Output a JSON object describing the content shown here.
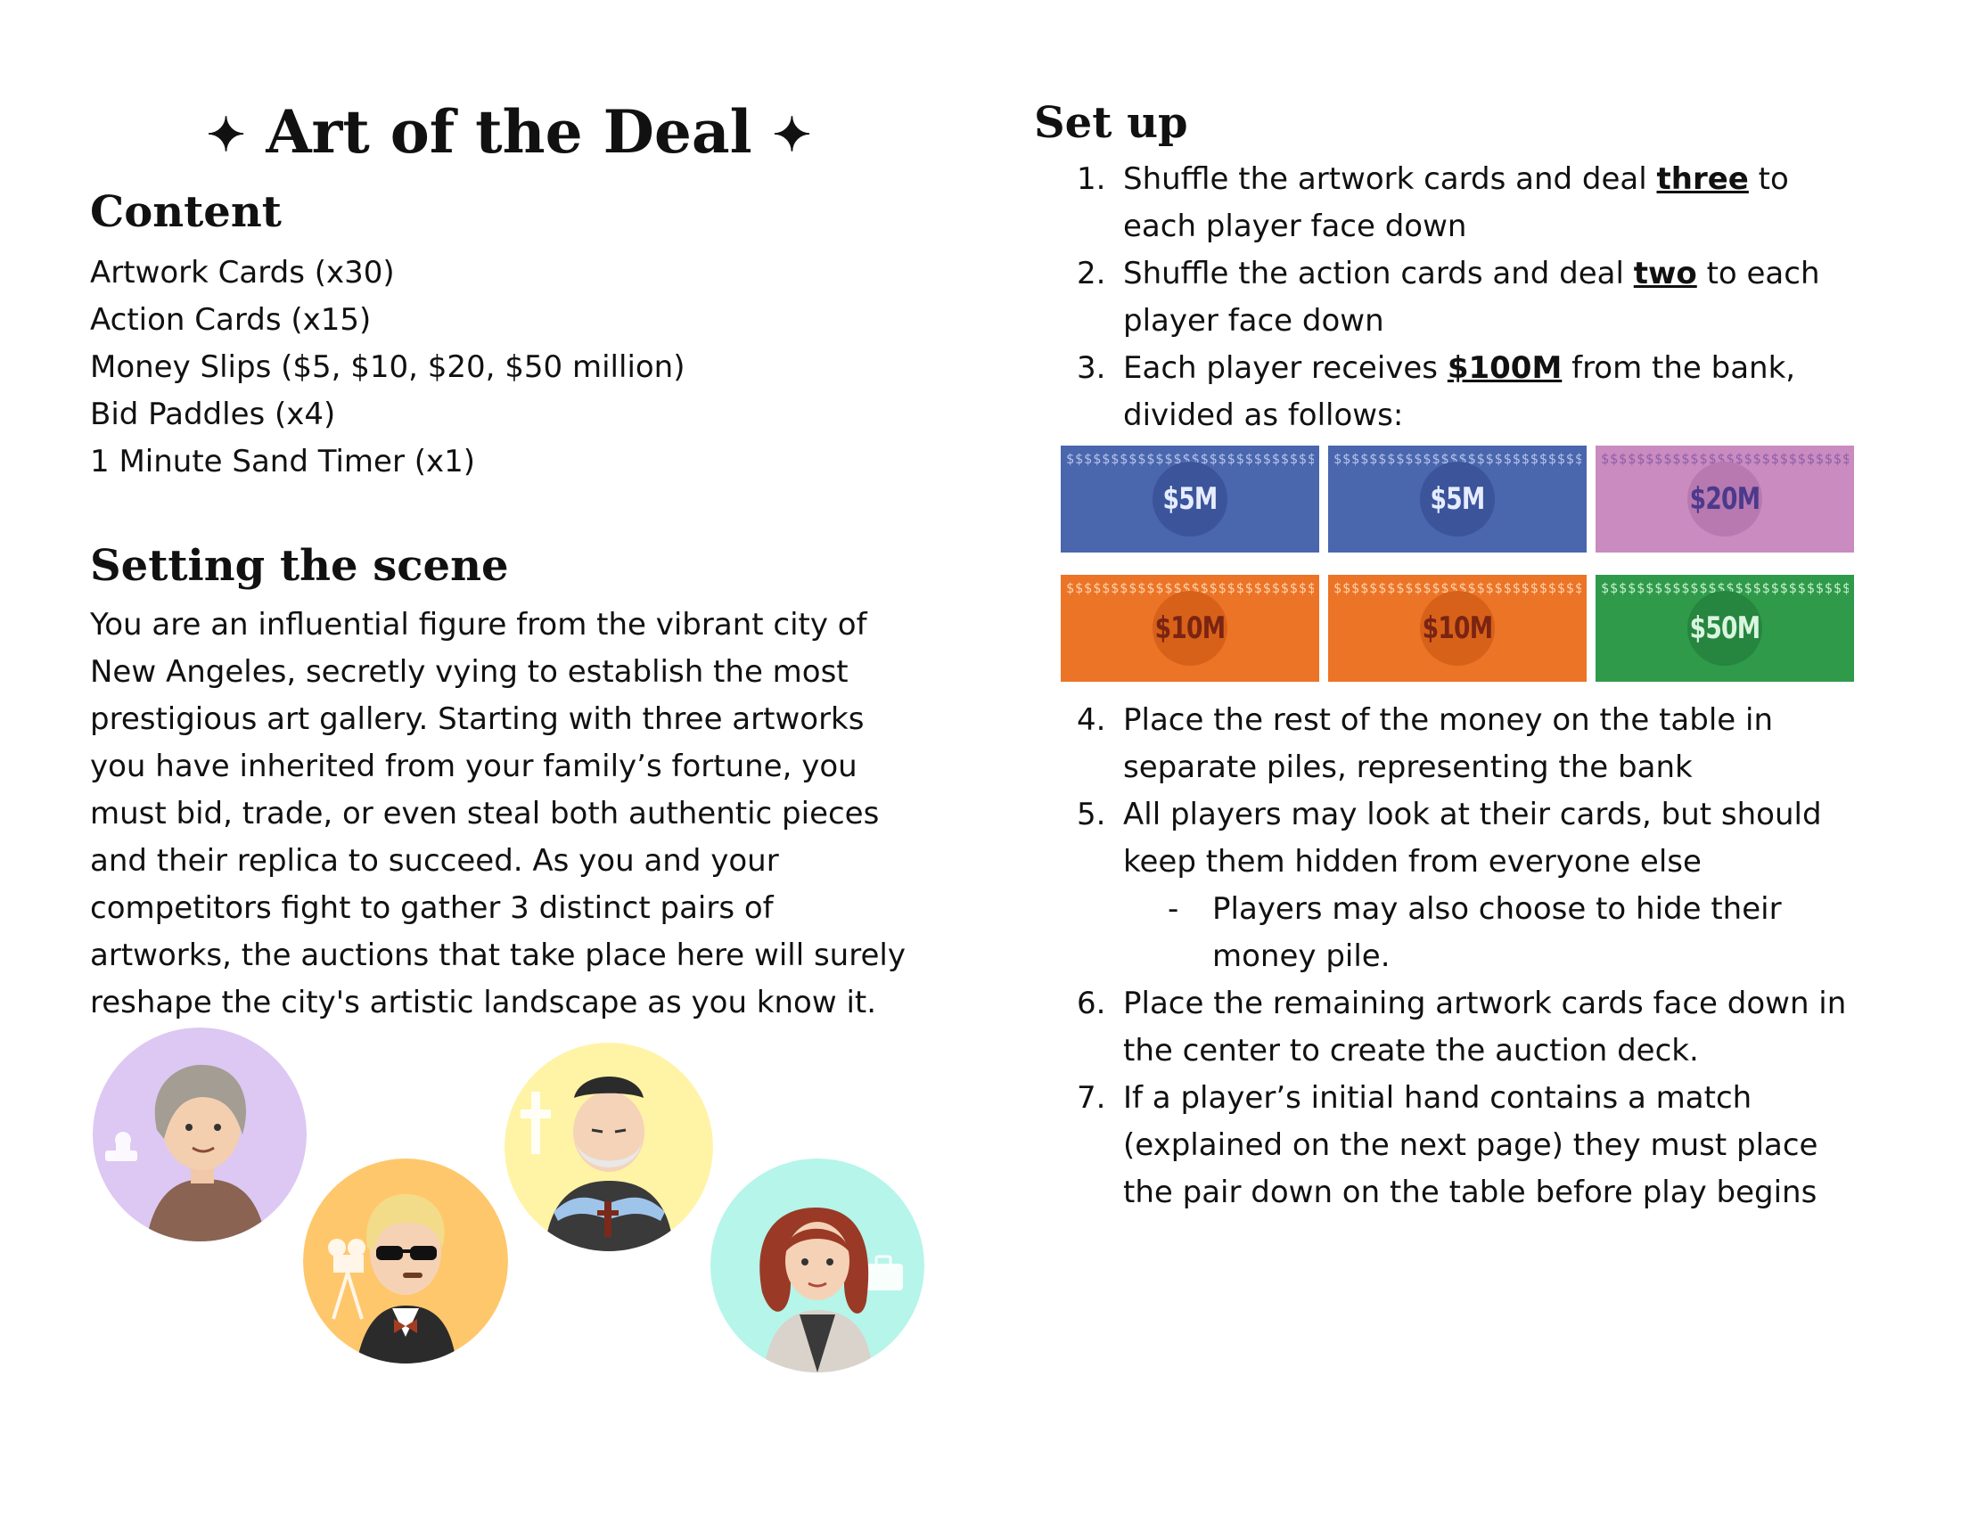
{
  "title": {
    "star_left": "✦",
    "text": "Art of the Deal",
    "star_right": "✦"
  },
  "content": {
    "heading": "Content",
    "items": [
      "Artwork Cards (x30)",
      "Action Cards (x15)",
      "Money Slips ($5, $10, $20, $50 million)",
      "Bid Paddles (x4)",
      "1 Minute Sand Timer (x1)"
    ]
  },
  "scene": {
    "heading": "Setting the scene",
    "lines": [
      "You are an influential figure from the vibrant city of",
      "New Angeles, secretly vying to establish the most",
      "prestigious art gallery. Starting with three artworks",
      "you have inherited from your family’s fortune, you",
      "must bid, trade, or even steal both authentic pieces",
      "and their replica to succeed. As you and your",
      "competitors fight to gather 3 distinct pairs of",
      "artworks, the auctions that take place here will surely",
      "reshape the city's artistic landscape as you know it."
    ],
    "avatars": [
      {
        "name": "elderly-woman",
        "color": "#dcc8f2"
      },
      {
        "name": "film-director",
        "color": "#ffc76b"
      },
      {
        "name": "priest",
        "color": "#fff3a6"
      },
      {
        "name": "businesswoman",
        "color": "#b5f5ea"
      }
    ]
  },
  "setup": {
    "heading": "Set up",
    "step1": {
      "num": "1.",
      "a": "Shuffle the artwork cards and deal ",
      "em": "three",
      "b": " to",
      "line2": "each player face down"
    },
    "step2": {
      "num": "2.",
      "a": "Shuffle the action cards and deal ",
      "em": "two",
      "b": " to each",
      "line2": "player face down"
    },
    "step3": {
      "num": "3.",
      "a": "Each player receives ",
      "em": "$100M",
      "b": " from the bank,",
      "line2": "divided as follows:"
    },
    "bills": [
      {
        "label": "$5M",
        "color": "#4a66ad",
        "pattern": "#b5c4ec",
        "ink": "#e6ecff",
        "disc": "#3b549a"
      },
      {
        "label": "$5M",
        "color": "#4a66ad",
        "pattern": "#b5c4ec",
        "ink": "#e6ecff",
        "disc": "#3b549a"
      },
      {
        "label": "$20M",
        "color": "#c98bc0",
        "pattern": "#8e5ea8",
        "ink": "#4b3a8c",
        "disc": "#b779b0"
      },
      {
        "label": "$10M",
        "color": "#ec7426",
        "pattern": "#ffd2ae",
        "ink": "#7a2412",
        "disc": "#d8611a"
      },
      {
        "label": "$10M",
        "color": "#ec7426",
        "pattern": "#ffd2ae",
        "ink": "#7a2412",
        "disc": "#d8611a"
      },
      {
        "label": "$50M",
        "color": "#2f9a4a",
        "pattern": "#c7f0cf",
        "ink": "#d9f5df",
        "disc": "#26853e"
      }
    ],
    "step4": {
      "num": "4.",
      "line1": "Place the rest of the money on the table in",
      "line2": "separate piles, representing the bank"
    },
    "step5": {
      "num": "5.",
      "line1": "All players may look at their cards, but should",
      "line2": "keep them hidden from everyone else"
    },
    "step5_sub": {
      "dash": "-",
      "line1": "Players may also choose to hide their",
      "line2": "money pile."
    },
    "step6": {
      "num": "6.",
      "line1": "Place the remaining artwork cards face down in",
      "line2": "the center to create the auction deck."
    },
    "step7": {
      "num": "7.",
      "line1": "If a player’s initial hand contains a match",
      "line2": "(explained on the next page) they must place",
      "line3": "the pair down on the table before play begins"
    }
  }
}
